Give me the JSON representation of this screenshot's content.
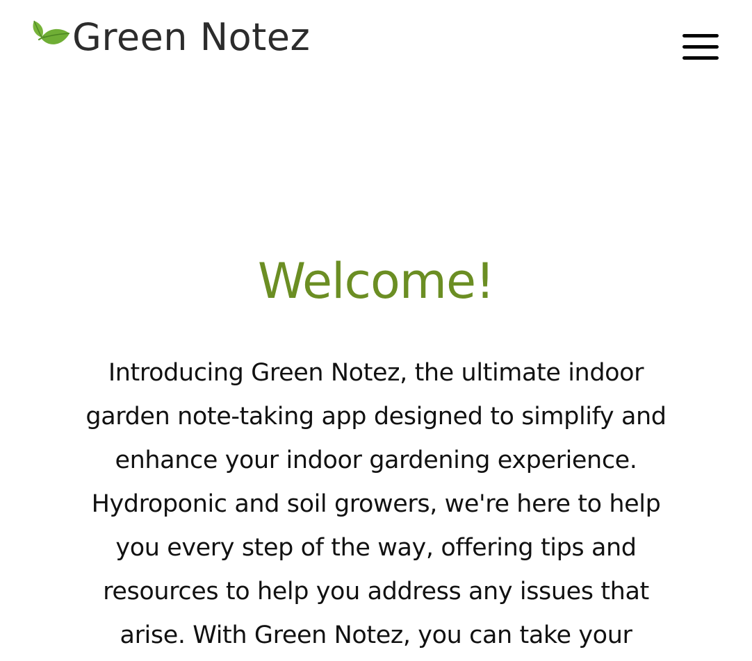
{
  "header": {
    "brand_name": "Green Notez",
    "logo_icon": "leaf-icon",
    "menu_icon": "hamburger-menu-icon"
  },
  "main": {
    "heading": "Welcome!",
    "intro_text": "Introducing Green Notez, the ultimate indoor garden note-taking app designed to simplify and enhance your indoor gardening experience. Hydroponic and soil growers, we're here to help you every step of the way, offering tips and resources to help you address any issues that arise. With Green Notez, you can take your"
  },
  "colors": {
    "accent_green": "#6b8e23",
    "leaf_light": "#8bc34a",
    "leaf_dark": "#5a9a2a",
    "text_dark": "#111111",
    "brand_text": "#2c2c2c",
    "background": "#ffffff"
  }
}
